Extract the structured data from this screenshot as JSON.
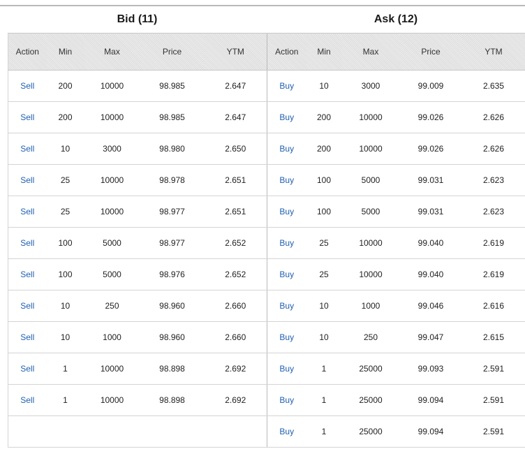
{
  "bid": {
    "title": "Bid (11)",
    "columns": [
      "Action",
      "Min",
      "Max",
      "Price",
      "YTM"
    ],
    "rows": [
      {
        "action": "Sell",
        "min": "200",
        "max": "10000",
        "price": "98.985",
        "ytm": "2.647"
      },
      {
        "action": "Sell",
        "min": "200",
        "max": "10000",
        "price": "98.985",
        "ytm": "2.647"
      },
      {
        "action": "Sell",
        "min": "10",
        "max": "3000",
        "price": "98.980",
        "ytm": "2.650"
      },
      {
        "action": "Sell",
        "min": "25",
        "max": "10000",
        "price": "98.978",
        "ytm": "2.651"
      },
      {
        "action": "Sell",
        "min": "25",
        "max": "10000",
        "price": "98.977",
        "ytm": "2.651"
      },
      {
        "action": "Sell",
        "min": "100",
        "max": "5000",
        "price": "98.977",
        "ytm": "2.652"
      },
      {
        "action": "Sell",
        "min": "100",
        "max": "5000",
        "price": "98.976",
        "ytm": "2.652"
      },
      {
        "action": "Sell",
        "min": "10",
        "max": "250",
        "price": "98.960",
        "ytm": "2.660"
      },
      {
        "action": "Sell",
        "min": "10",
        "max": "1000",
        "price": "98.960",
        "ytm": "2.660"
      },
      {
        "action": "Sell",
        "min": "1",
        "max": "10000",
        "price": "98.898",
        "ytm": "2.692"
      },
      {
        "action": "Sell",
        "min": "1",
        "max": "10000",
        "price": "98.898",
        "ytm": "2.692"
      }
    ]
  },
  "ask": {
    "title": "Ask (12)",
    "columns": [
      "Action",
      "Min",
      "Max",
      "Price",
      "YTM"
    ],
    "rows": [
      {
        "action": "Buy",
        "min": "10",
        "max": "3000",
        "price": "99.009",
        "ytm": "2.635"
      },
      {
        "action": "Buy",
        "min": "200",
        "max": "10000",
        "price": "99.026",
        "ytm": "2.626"
      },
      {
        "action": "Buy",
        "min": "200",
        "max": "10000",
        "price": "99.026",
        "ytm": "2.626"
      },
      {
        "action": "Buy",
        "min": "100",
        "max": "5000",
        "price": "99.031",
        "ytm": "2.623"
      },
      {
        "action": "Buy",
        "min": "100",
        "max": "5000",
        "price": "99.031",
        "ytm": "2.623"
      },
      {
        "action": "Buy",
        "min": "25",
        "max": "10000",
        "price": "99.040",
        "ytm": "2.619"
      },
      {
        "action": "Buy",
        "min": "25",
        "max": "10000",
        "price": "99.040",
        "ytm": "2.619"
      },
      {
        "action": "Buy",
        "min": "10",
        "max": "1000",
        "price": "99.046",
        "ytm": "2.616"
      },
      {
        "action": "Buy",
        "min": "10",
        "max": "250",
        "price": "99.047",
        "ytm": "2.615"
      },
      {
        "action": "Buy",
        "min": "1",
        "max": "25000",
        "price": "99.093",
        "ytm": "2.591"
      },
      {
        "action": "Buy",
        "min": "1",
        "max": "25000",
        "price": "99.094",
        "ytm": "2.591"
      },
      {
        "action": "Buy",
        "min": "1",
        "max": "25000",
        "price": "99.094",
        "ytm": "2.591"
      }
    ]
  },
  "colors": {
    "link": "#1f5fb0",
    "header_bg": "#e3e3e3",
    "border": "#d4d4d4"
  }
}
